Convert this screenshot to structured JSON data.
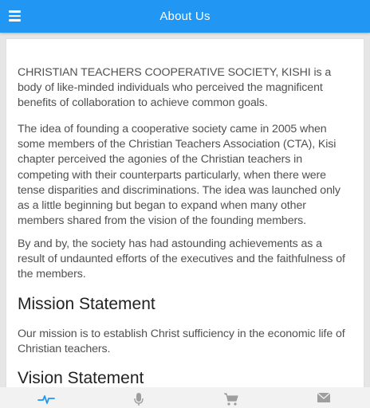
{
  "header": {
    "title": "About Us",
    "menu_icon": "hamburger-menu-icon",
    "background": "#2196f3"
  },
  "about": {
    "paragraphs": [
      "CHRISTIAN TEACHERS COOPERATIVE SOCIETY, KISHI is a body of like-minded individuals who perceived the magnificent benefits of collaboration to achieve common goals.",
      "The idea of founding a cooperative society came in 2005 when some members of the Christian Teachers Association (CTA), Kisi chapter perceived the agonies of the Christian teachers in competing with their counterparts particularly, when there were tense disparities and discriminations. The idea was launched only as a little beginning but began to expand when many other members shared from the vision of the founding members.",
      "By and by, the society has had astounding achievements as a result of undaunted efforts of the executives and the faithfulness of the members."
    ],
    "mission_heading": "Mission Statement",
    "mission_text": "Our mission is to establish Christ sufficiency in the economic life of Christian teachers.",
    "vision_heading": "Vision Statement"
  },
  "bottom_nav": {
    "items": [
      {
        "icon": "pulse-icon",
        "active": true
      },
      {
        "icon": "microphone-icon",
        "active": false
      },
      {
        "icon": "cart-icon",
        "active": false
      },
      {
        "icon": "envelope-icon",
        "active": false
      }
    ],
    "active_color": "#2196f3",
    "inactive_color": "#9e9e9e"
  }
}
